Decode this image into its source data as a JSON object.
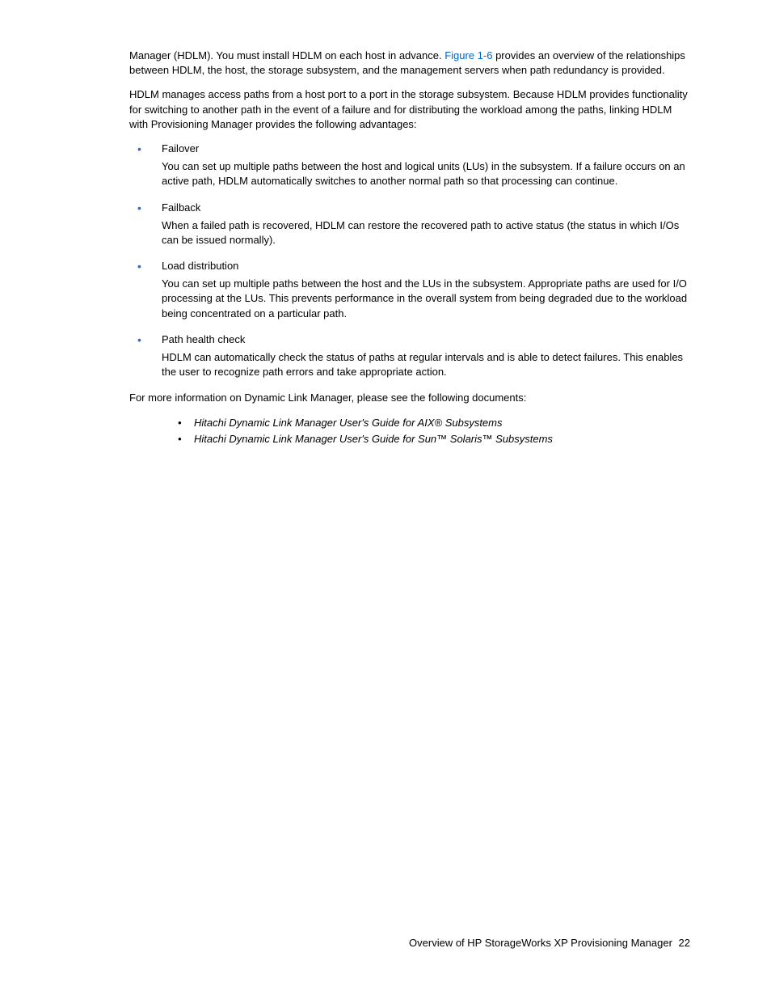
{
  "para1_pre": "Manager (HDLM). You must install HDLM on each host in advance. ",
  "para1_link": "Figure 1-6",
  "para1_post": " provides an overview of the relationships between HDLM, the host, the storage subsystem, and the management servers when path redundancy is provided.",
  "para2": "HDLM manages access paths from a host port to a port in the storage subsystem. Because HDLM provides functionality for switching to another path in the event of a failure and for distributing the workload among the paths, linking HDLM with Provisioning Manager provides the following advantages:",
  "features": [
    {
      "title": "Failover",
      "body": "You can set up multiple paths between the host and logical units (LUs) in the subsystem. If a failure occurs on an active path, HDLM automatically switches to another normal path so that processing can continue."
    },
    {
      "title": "Failback",
      "body": "When a failed path is recovered, HDLM can restore the recovered path to active status (the status in which I/Os can be issued normally)."
    },
    {
      "title": "Load distribution",
      "body": "You can set up multiple paths between the host and the LUs in the subsystem. Appropriate paths are used for I/O processing at the LUs. This prevents performance in the overall system from being degraded due to the workload being concentrated on a particular path."
    },
    {
      "title": "Path health check",
      "body": "HDLM can automatically check the status of paths at regular intervals and is able to detect failures. This enables the user to recognize path errors and take appropriate action."
    }
  ],
  "para3": "For more information on Dynamic Link Manager, please see the following documents:",
  "docs": [
    "Hitachi Dynamic Link Manager User's Guide for AIX® Subsystems",
    "Hitachi Dynamic Link Manager User's Guide for Sun™ Solaris™ Subsystems"
  ],
  "footer_text": "Overview of HP StorageWorks XP Provisioning Manager",
  "footer_page": "22"
}
